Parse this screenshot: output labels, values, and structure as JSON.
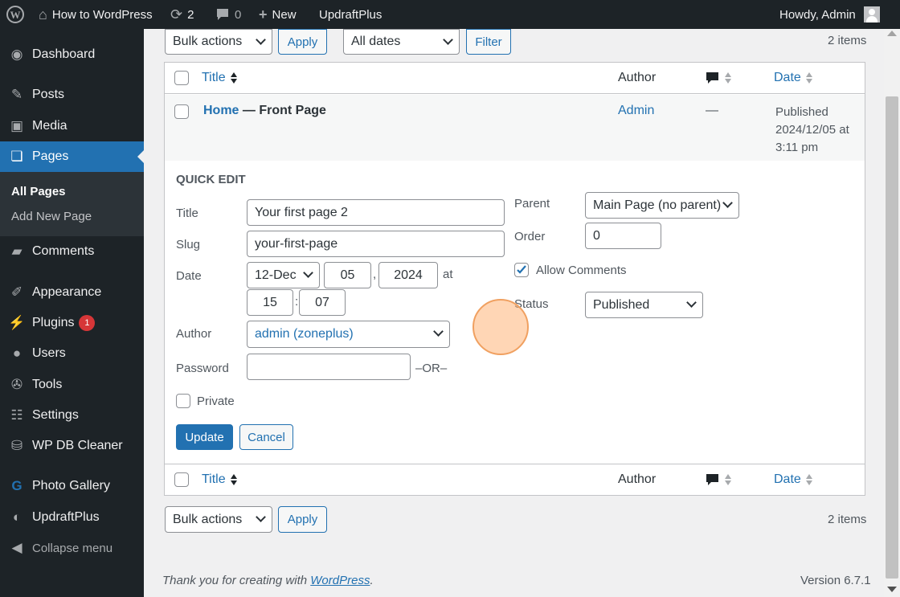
{
  "adminbar": {
    "site_name": "How to WordPress",
    "updates_count": "2",
    "comments_count": "0",
    "new_label": "New",
    "plugin_link": "UpdraftPlus",
    "howdy": "Howdy, Admin"
  },
  "sidebar": {
    "items": [
      {
        "label": "Dashboard"
      },
      {
        "label": "Posts"
      },
      {
        "label": "Media"
      },
      {
        "label": "Pages"
      },
      {
        "label": "Comments"
      },
      {
        "label": "Appearance"
      },
      {
        "label": "Plugins",
        "badge": "1"
      },
      {
        "label": "Users"
      },
      {
        "label": "Tools"
      },
      {
        "label": "Settings"
      },
      {
        "label": "WP DB Cleaner"
      },
      {
        "label": "Photo Gallery"
      },
      {
        "label": "UpdraftPlus"
      },
      {
        "label": "Collapse menu"
      }
    ],
    "submenu": [
      {
        "label": "All Pages"
      },
      {
        "label": "Add New Page"
      }
    ]
  },
  "top_nav": {
    "bulk_actions": "Bulk actions",
    "apply": "Apply",
    "dates": "All dates",
    "filter": "Filter",
    "items_count": "2 items"
  },
  "table": {
    "columns": {
      "title": "Title",
      "author": "Author",
      "date": "Date"
    },
    "row": {
      "title": "Home",
      "state": "— Front Page",
      "author": "Admin",
      "comments": "—",
      "date_status": "Published",
      "date_value": "2024/12/05 at",
      "date_time": "3:11 pm"
    }
  },
  "quick_edit": {
    "heading": "QUICK EDIT",
    "title_label": "Title",
    "title_value": "Your first page 2",
    "slug_label": "Slug",
    "slug_value": "your-first-page",
    "date_label": "Date",
    "month": "12-Dec",
    "day": "05",
    "comma": ",",
    "year": "2024",
    "at": "at",
    "hour": "15",
    "colon": ":",
    "minute": "07",
    "author_label": "Author",
    "author_value": "admin (zoneplus)",
    "password_label": "Password",
    "password_value": "",
    "or": "–OR–",
    "private_label": "Private",
    "parent_label": "Parent",
    "parent_value": "Main Page (no parent)",
    "order_label": "Order",
    "order_value": "0",
    "allow_comments": "Allow Comments",
    "status_label": "Status",
    "status_value": "Published",
    "update": "Update",
    "cancel": "Cancel"
  },
  "bottom_nav": {
    "bulk_actions": "Bulk actions",
    "apply": "Apply",
    "items_count": "2 items"
  },
  "footer": {
    "thanks": "Thank you for creating with ",
    "wp_link": "WordPress",
    "period": ".",
    "version": "Version 6.7.1"
  }
}
